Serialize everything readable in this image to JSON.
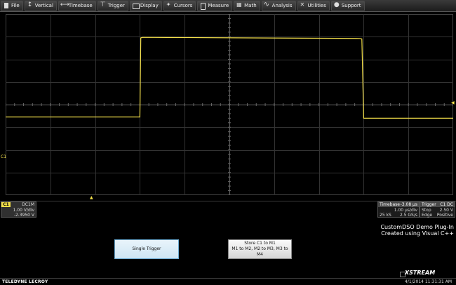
{
  "menu": [
    {
      "label": "File",
      "icon": "file-icon"
    },
    {
      "label": "Vertical",
      "icon": "vertical-icon"
    },
    {
      "label": "Timebase",
      "icon": "timebase-icon"
    },
    {
      "label": "Trigger",
      "icon": "trigger-icon"
    },
    {
      "label": "Display",
      "icon": "display-icon"
    },
    {
      "label": "Cursors",
      "icon": "cursors-icon"
    },
    {
      "label": "Measure",
      "icon": "measure-icon"
    },
    {
      "label": "Math",
      "icon": "math-icon"
    },
    {
      "label": "Analysis",
      "icon": "analysis-icon"
    },
    {
      "label": "Utilities",
      "icon": "utilities-icon"
    },
    {
      "label": "Support",
      "icon": "support-icon"
    }
  ],
  "scope": {
    "channel_marker": "C1",
    "trace_color": "#f4e04a",
    "grid": {
      "divisions_x": 10,
      "divisions_y": 8
    }
  },
  "chart_data": {
    "type": "line",
    "x": [
      -5,
      -2.0,
      -1.98,
      -1.94,
      2.92,
      2.96,
      3.0,
      5
    ],
    "y": [
      -0.55,
      -0.55,
      2.95,
      2.97,
      2.92,
      2.9,
      -0.6,
      -0.6
    ],
    "xlim": [
      -5,
      5
    ],
    "ylim": [
      -4,
      4
    ],
    "grid": true
  },
  "channel": {
    "tag": "C1",
    "coupling": "DC1M",
    "vdiv": "1.00 V/div",
    "offset": "-2.3950 V"
  },
  "timebase": {
    "label": "Timebase",
    "delay": "-3.08 µs",
    "tdiv": "1.00 µs/div",
    "samples": "25 kS",
    "rate": "2.5 GS/s"
  },
  "trigger": {
    "label": "Trigger",
    "source": "C1 DC",
    "mode": "Stop",
    "level": "2.50 V",
    "type": "Edge",
    "slope": "Positive"
  },
  "plugin": {
    "title_line1": "CustomDSO Demo Plug-In",
    "title_line2": "Created using Visual C++",
    "single_trigger_label": "Single Trigger",
    "store_line1": "Store C1 to M1",
    "store_line2": "M1 to M2, M2 to M3, M3 to M4"
  },
  "footer": {
    "brand": "TELEDYNE LECROY",
    "logo_text": "XSTREAM",
    "datetime": "4/1/2014 11:31:31 AM"
  }
}
